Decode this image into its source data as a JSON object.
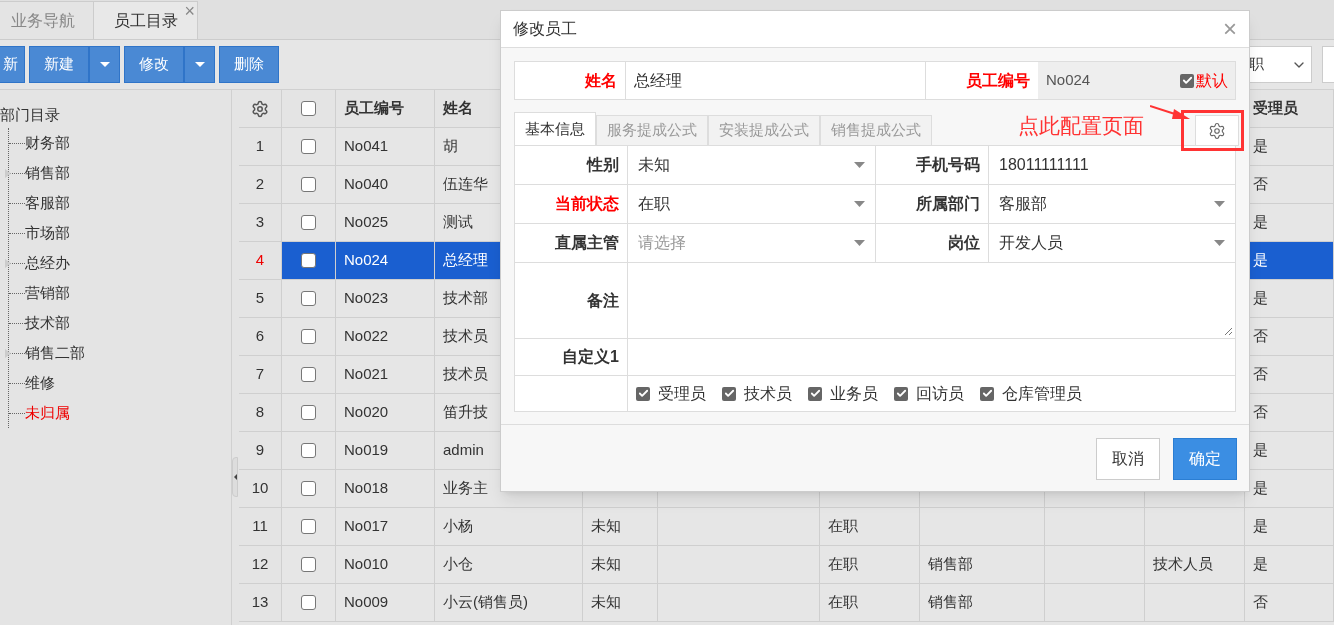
{
  "tabs": [
    {
      "label": "业务导航",
      "selected": false
    },
    {
      "label": "员工目录",
      "selected": true,
      "close": "×"
    }
  ],
  "toolbar": {
    "buttons": [
      {
        "label": "新",
        "dropdown": false
      },
      {
        "label": "新建",
        "dropdown": true
      },
      {
        "label": "修改",
        "dropdown": true
      },
      {
        "label": "删除",
        "dropdown": false
      }
    ],
    "filter": {
      "value": "职"
    }
  },
  "tree": {
    "label": "部门目录",
    "children": [
      {
        "label": "财务部",
        "expandable": false,
        "highlighted": false
      },
      {
        "label": "销售部",
        "expandable": true,
        "highlighted": false
      },
      {
        "label": "客服部",
        "expandable": false,
        "highlighted": false
      },
      {
        "label": "市场部",
        "expandable": false,
        "highlighted": false
      },
      {
        "label": "总经办",
        "expandable": true,
        "highlighted": false
      },
      {
        "label": "营销部",
        "expandable": false,
        "highlighted": false
      },
      {
        "label": "技术部",
        "expandable": false,
        "highlighted": false
      },
      {
        "label": "销售二部",
        "expandable": true,
        "highlighted": false
      },
      {
        "label": "维修",
        "expandable": false,
        "highlighted": false
      },
      {
        "label": "未归属",
        "expandable": false,
        "highlighted": true
      }
    ]
  },
  "table": {
    "select_all": false,
    "columns": {
      "id": "员工编号",
      "name": "姓名",
      "acceptor": "受理员"
    },
    "rows": [
      {
        "number": "1",
        "checked": false,
        "selected": false,
        "id": "No041",
        "name": "胡",
        "acceptor": "是"
      },
      {
        "number": "2",
        "checked": false,
        "selected": false,
        "id": "No040",
        "name": "伍连华",
        "acceptor": "否"
      },
      {
        "number": "3",
        "checked": false,
        "selected": false,
        "id": "No025",
        "name": "测试",
        "acceptor": "是"
      },
      {
        "number": "4",
        "checked": false,
        "selected": true,
        "id": "No024",
        "name": "总经理",
        "acceptor": "是"
      },
      {
        "number": "5",
        "checked": false,
        "selected": false,
        "id": "No023",
        "name": "技术部",
        "acceptor": "是"
      },
      {
        "number": "6",
        "checked": false,
        "selected": false,
        "id": "No022",
        "name": "技术员",
        "acceptor": "否"
      },
      {
        "number": "7",
        "checked": false,
        "selected": false,
        "id": "No021",
        "name": "技术员",
        "acceptor": "否"
      },
      {
        "number": "8",
        "checked": false,
        "selected": false,
        "id": "No020",
        "name": "笛升技",
        "acceptor": "否"
      },
      {
        "number": "9",
        "checked": false,
        "selected": false,
        "id": "No019",
        "name": "admin",
        "acceptor": "是"
      },
      {
        "number": "10",
        "checked": false,
        "selected": false,
        "id": "No018",
        "name": "业务主",
        "acceptor": "是"
      },
      {
        "number": "11",
        "checked": false,
        "selected": false,
        "id": "No017",
        "name": "小杨",
        "gender": "未知",
        "status": "在职",
        "acceptor": "是"
      },
      {
        "number": "12",
        "checked": false,
        "selected": false,
        "id": "No010",
        "name": "小仓",
        "gender": "未知",
        "status": "在职",
        "department": "销售部",
        "position": "技术人员",
        "acceptor": "是"
      },
      {
        "number": "13",
        "checked": false,
        "selected": false,
        "id": "No009",
        "name": "小云(销售员)",
        "gender": "未知",
        "status": "在职",
        "department": "销售部",
        "acceptor": "否"
      }
    ]
  },
  "dialog": {
    "title": "修改员工",
    "close": "×",
    "name": {
      "label": "姓名",
      "value": "总经理",
      "required": true
    },
    "code": {
      "label": "员工编号",
      "value": "No024",
      "required": true
    },
    "default": {
      "label": "默认",
      "checked": true
    },
    "tabs": [
      {
        "label": "基本信息",
        "selected": true
      },
      {
        "label": "服务提成公式",
        "selected": false
      },
      {
        "label": "安装提成公式",
        "selected": false
      },
      {
        "label": "销售提成公式",
        "selected": false
      }
    ],
    "annotation": "点此配置页面",
    "fields": [
      {
        "label": "性别",
        "required": false,
        "kind": "select",
        "value": "未知"
      },
      {
        "label": "手机号码",
        "required": false,
        "kind": "text",
        "value": "18011111111"
      },
      {
        "label": "当前状态",
        "required": true,
        "kind": "select",
        "value": "在职"
      },
      {
        "label": "所属部门",
        "required": false,
        "kind": "select",
        "value": "客服部"
      },
      {
        "label": "直属主管",
        "required": false,
        "kind": "select",
        "placeholder": "请选择"
      },
      {
        "label": "岗位",
        "required": false,
        "kind": "select",
        "value": "开发人员"
      }
    ],
    "remark": {
      "label": "备注"
    },
    "custom": {
      "label": "自定义1"
    },
    "roles": [
      {
        "label": "受理员",
        "checked": true
      },
      {
        "label": "技术员",
        "checked": true
      },
      {
        "label": "业务员",
        "checked": true
      },
      {
        "label": "回访员",
        "checked": true
      },
      {
        "label": "仓库管理员",
        "checked": true
      }
    ],
    "buttons": [
      {
        "label": "取消",
        "primary": false
      },
      {
        "label": "确定",
        "primary": true
      }
    ]
  }
}
